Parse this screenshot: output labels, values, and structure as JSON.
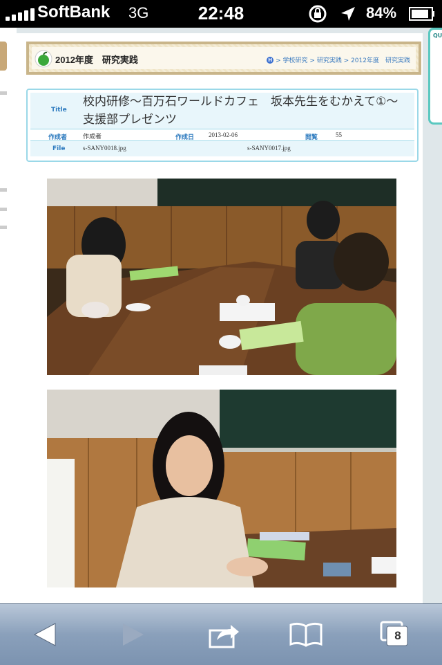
{
  "status_bar": {
    "carrier": "SoftBank",
    "network": "3G",
    "time": "22:48",
    "battery": "84%",
    "icons": [
      "signal-icon",
      "orientation-lock-icon",
      "location-icon",
      "battery-icon"
    ]
  },
  "header": {
    "title": "2012年度　研究実践",
    "breadcrumb": "> 学校研究 > 研究実践 > 2012年度　研究実践",
    "home_icon": "H"
  },
  "side_card": {
    "label": "QU"
  },
  "info": {
    "title_label": "Title",
    "title_value": "校内研修〜百万石ワールドカフェ　坂本先生をむかえて①〜　支援部プレゼンツ",
    "author_label": "作成者",
    "author_value": "作成者",
    "date_label": "作成日",
    "date_value": "2013-02-06",
    "views_label": "閲覧",
    "views_value": "55",
    "file_label": "File",
    "files": [
      "s-SANY0018.jpg",
      "s-SANY0017.jpg"
    ]
  },
  "toolbar": {
    "tabs_count": "8",
    "buttons": [
      "back-icon",
      "forward-icon",
      "share-icon",
      "bookmarks-icon",
      "tabs-icon"
    ]
  },
  "colors": {
    "accent": "#2e7bbf",
    "header_border": "#c9b58a",
    "info_border": "#9ad8e8"
  }
}
